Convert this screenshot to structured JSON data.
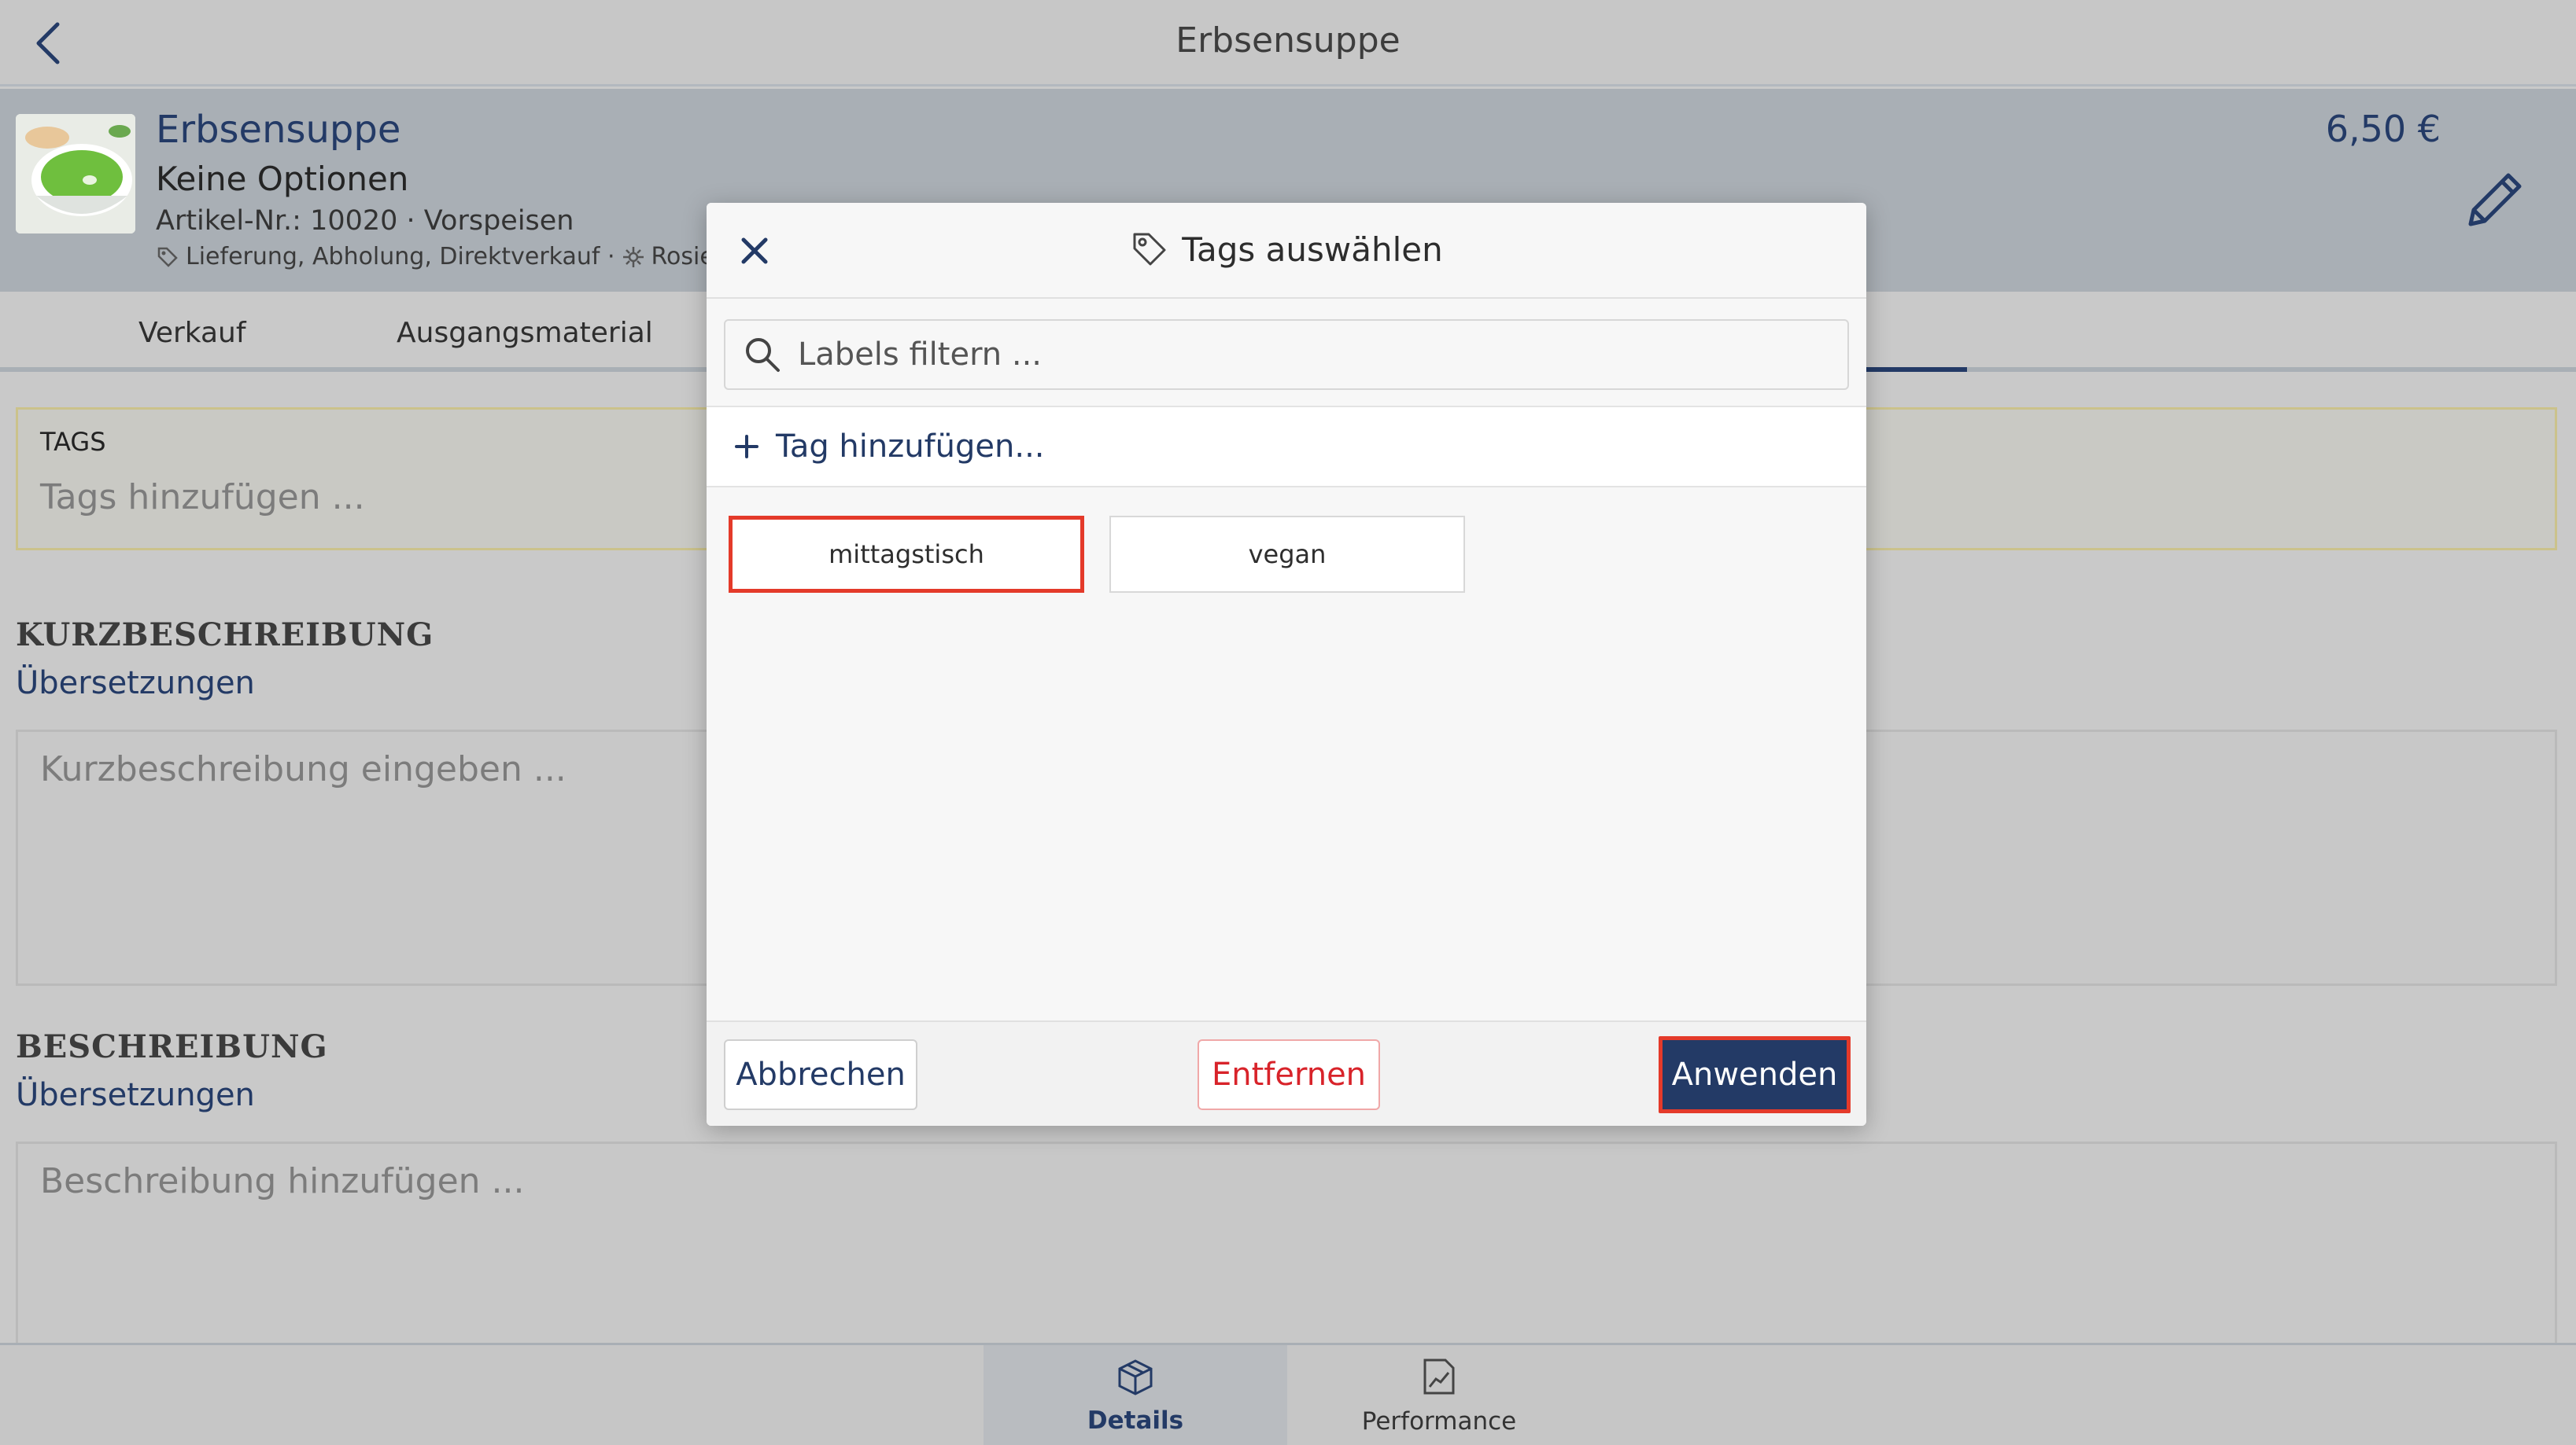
{
  "topbar": {
    "title": "Erbsensuppe"
  },
  "product": {
    "name": "Erbsensuppe",
    "options": "Keine Optionen",
    "article": "Artikel-Nr.: 10020 · Vorspeisen",
    "channels": "Lieferung, Abholung, Direktverkauf ·",
    "store": "Rosie's R",
    "price": "6,50 €"
  },
  "tabs": [
    {
      "label": "Verkauf"
    },
    {
      "label": "Ausgangsmaterial"
    }
  ],
  "tags_section": {
    "label": "TAGS",
    "placeholder": "Tags hinzufügen ..."
  },
  "short_description": {
    "title": "KURZBESCHREIBUNG",
    "link": "Übersetzungen",
    "placeholder": "Kurzbeschreibung eingeben ..."
  },
  "description": {
    "title": "BESCHREIBUNG",
    "link": "Übersetzungen",
    "placeholder": "Beschreibung hinzufügen ..."
  },
  "bottom_nav": [
    {
      "label": "Details",
      "icon": "box-icon",
      "active": true
    },
    {
      "label": "Performance",
      "icon": "chart-document-icon",
      "active": false
    }
  ],
  "modal": {
    "title": "Tags auswählen",
    "title_icon": "tag-icon",
    "search_placeholder": "Labels filtern ...",
    "add_tag_label": "Tag hinzufügen...",
    "tags": [
      {
        "label": "mittagstisch",
        "selected": true
      },
      {
        "label": "vegan",
        "selected": false
      }
    ],
    "buttons": {
      "cancel": "Abbrechen",
      "remove": "Entfernen",
      "apply": "Anwenden"
    }
  },
  "colors": {
    "accent": "#233a66",
    "danger": "#d8232a",
    "highlight": "#e43a2a"
  }
}
